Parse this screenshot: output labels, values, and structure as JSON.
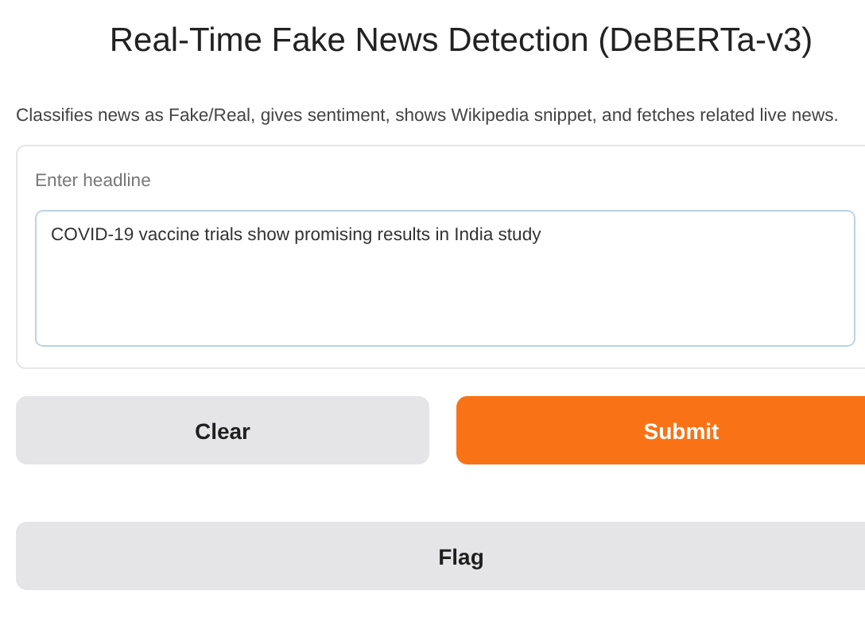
{
  "title": "Real-Time Fake News Detection (DeBERTa-v3)",
  "description": "Classifies news as Fake/Real, gives sentiment, shows Wikipedia snippet, and fetches related live news.",
  "input": {
    "label": "Enter headline",
    "value": "COVID-19 vaccine trials show promising results in India study"
  },
  "buttons": [
    {
      "label": "Clear",
      "kind": "secondary"
    },
    {
      "label": "Submit",
      "kind": "primary"
    }
  ],
  "flag_button": {
    "label": "Flag",
    "kind": "secondary"
  }
}
